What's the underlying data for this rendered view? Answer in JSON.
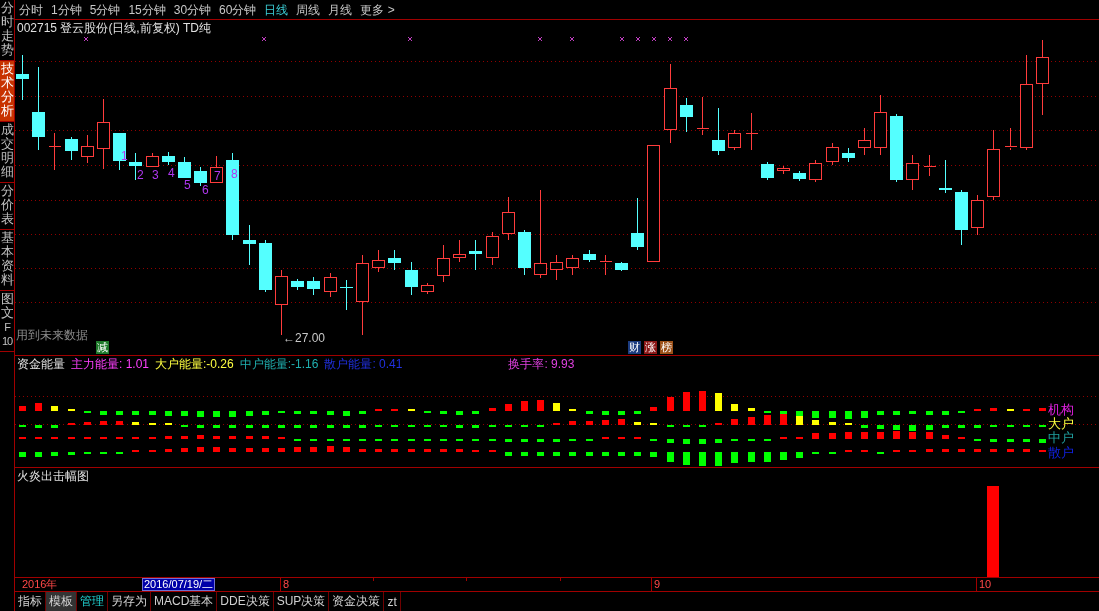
{
  "sidebar": {
    "tabs": [
      {
        "label": "分时走势",
        "selected": false
      },
      {
        "label": "技术分析",
        "selected": true
      },
      {
        "label": "成交明细",
        "selected": false
      },
      {
        "label": "分价表",
        "selected": false
      },
      {
        "label": "基本资料",
        "selected": false
      },
      {
        "label": "图文F10",
        "selected": false
      }
    ]
  },
  "period_tabs": [
    {
      "label": "分时",
      "selected": false
    },
    {
      "label": "1分钟",
      "selected": false
    },
    {
      "label": "5分钟",
      "selected": false
    },
    {
      "label": "15分钟",
      "selected": false
    },
    {
      "label": "30分钟",
      "selected": false
    },
    {
      "label": "60分钟",
      "selected": false
    },
    {
      "label": "日线",
      "selected": true
    },
    {
      "label": "周线",
      "selected": false
    },
    {
      "label": "月线",
      "selected": false
    },
    {
      "label": "更多 >",
      "selected": false
    }
  ],
  "main_chart": {
    "title": "002715 登云股份(日线,前复权) TD纯",
    "candle_labels": [
      "1",
      "2",
      "3",
      "4",
      "5",
      "6",
      "7",
      "8"
    ],
    "low_price_label": "←27.00",
    "note": "用到未来数据",
    "badges": [
      {
        "text": "减",
        "color": "#1e7a2a"
      },
      {
        "text": "财",
        "color": "#1c3c80"
      },
      {
        "text": "涨",
        "color": "#8c1818"
      },
      {
        "text": "榜",
        "color": "#9c5018"
      }
    ]
  },
  "energy_panel": {
    "title": "资金能量",
    "readings": [
      {
        "text": "主力能量: 1.01",
        "color": "#ff40ff"
      },
      {
        "text": "大户能量:-0.26",
        "color": "#ffff40"
      },
      {
        "text": "中户能量:-1.16",
        "color": "#20b0b0"
      },
      {
        "text": "散户能量: 0.41",
        "color": "#2030e0"
      }
    ],
    "turnover": "换手率: 9.93",
    "legend": [
      {
        "label": "机构",
        "color": "#e020e0"
      },
      {
        "label": "大户",
        "color": "#ffff40"
      },
      {
        "label": "中户",
        "color": "#20a0a0"
      },
      {
        "label": "散户",
        "color": "#1020e0"
      }
    ]
  },
  "signal_panel": {
    "title": "火炎出击幅图"
  },
  "date_axis": {
    "year": "2016年",
    "cursor_date": "2016/07/19/二",
    "months": [
      "8",
      "9",
      "10"
    ]
  },
  "bottom_tabs": [
    {
      "label": "指标",
      "selected": false,
      "highlighted": false
    },
    {
      "label": "模板",
      "selected": false,
      "highlighted": true
    },
    {
      "label": "管理",
      "selected": true,
      "highlighted": false
    },
    {
      "label": "另存为",
      "selected": false,
      "highlighted": false
    },
    {
      "label": "MACD基本",
      "selected": false,
      "highlighted": false
    },
    {
      "label": "DDE决策",
      "selected": false,
      "highlighted": false
    },
    {
      "label": "SUP决策",
      "selected": false,
      "highlighted": false
    },
    {
      "label": "资金决策",
      "selected": false,
      "highlighted": false
    },
    {
      "label": "zt",
      "selected": false,
      "highlighted": false
    }
  ]
}
